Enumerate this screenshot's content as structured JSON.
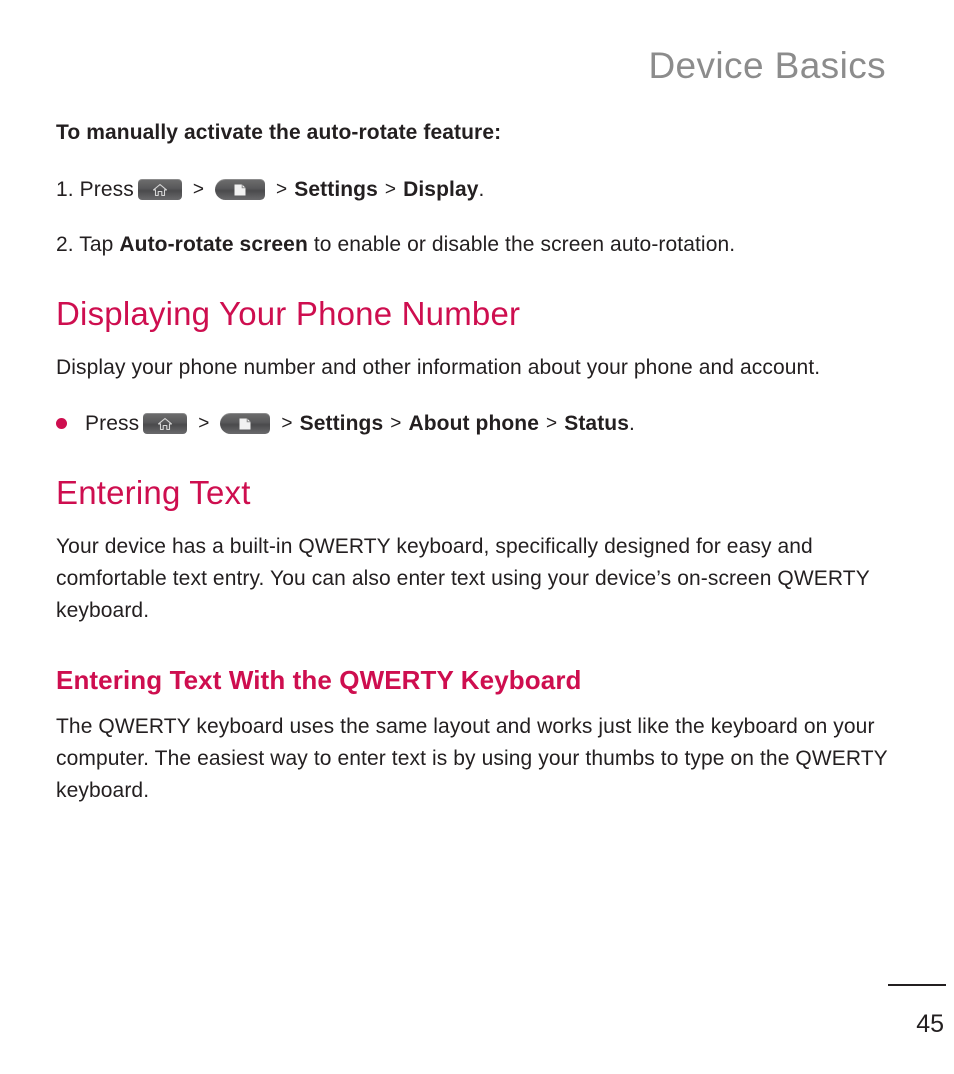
{
  "page": {
    "running_header": "Device Basics",
    "folio": "45",
    "accent_color": "#ce0e4f",
    "header_color": "#8c8c8c",
    "text_color": "#231f20",
    "background_color": "#ffffff"
  },
  "sections": {
    "auto_rotate": {
      "lead": "To manually activate the auto-rotate feature:",
      "step1": {
        "number": "1. ",
        "verb": "Press",
        "home_key": "home-key-icon",
        "menu_key": "menu-key-icon",
        "sep1": ">",
        "sep2": ">",
        "sep3": ">",
        "target1": "Settings",
        "target2": "Display",
        "period": "."
      },
      "step2": {
        "prefix": "2. Tap ",
        "bold": "Auto-rotate screen",
        "suffix": " to enable or disable the screen auto-rotation."
      }
    },
    "displaying_phone_number": {
      "heading": "Displaying Your Phone Number",
      "paragraph": "Display your phone number and other information about your phone and account.",
      "bullet": {
        "verb": "Press",
        "home_key": "home-key-icon",
        "menu_key": "menu-key-icon",
        "sep1": ">",
        "sep2": ">",
        "sep3": ">",
        "sep4": ">",
        "target1": "Settings",
        "target2": "About phone",
        "target3": "Status",
        "period": "."
      }
    },
    "entering_text": {
      "heading": "Entering Text",
      "paragraph": "Your device has a built-in QWERTY keyboard, specifically designed for easy and comfortable text entry. You can also enter text using your device’s on-screen QWERTY keyboard.",
      "subheading": "Entering Text With the QWERTY Keyboard",
      "sub_paragraph": "The QWERTY keyboard uses the same layout and works just like the keyboard on your computer. The easiest way to enter text is by using your thumbs to type on the QWERTY keyboard."
    }
  }
}
